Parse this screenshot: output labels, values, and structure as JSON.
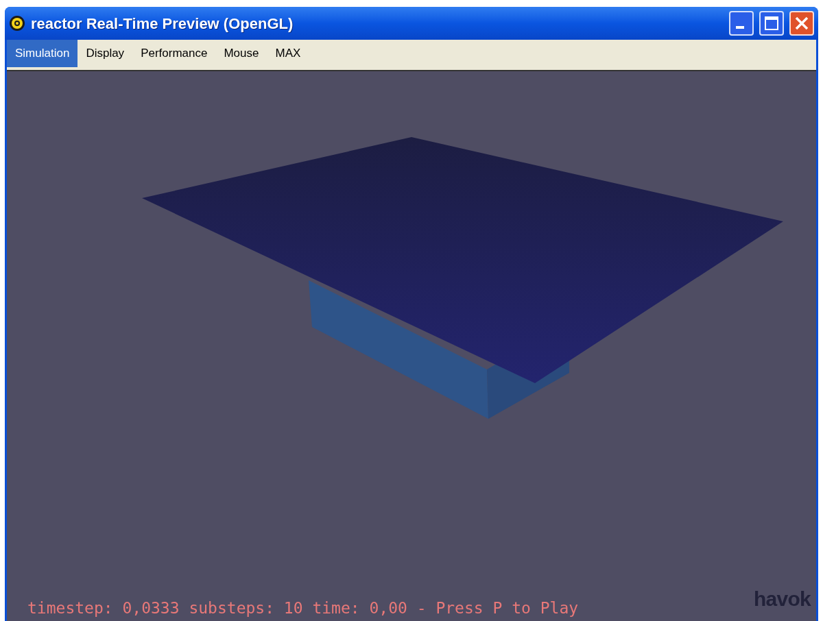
{
  "window": {
    "title": "reactor Real-Time Preview (OpenGL)"
  },
  "menu": [
    {
      "label": "Simulation",
      "selected": true
    },
    {
      "label": "Display",
      "selected": false
    },
    {
      "label": "Performance",
      "selected": false
    },
    {
      "label": "Mouse",
      "selected": false
    },
    {
      "label": "MAX",
      "selected": false
    }
  ],
  "viewport": {
    "status_text": "timestep: 0,0333 substeps: 10 time: 0,00 - Press P to Play",
    "logo": "havok"
  }
}
